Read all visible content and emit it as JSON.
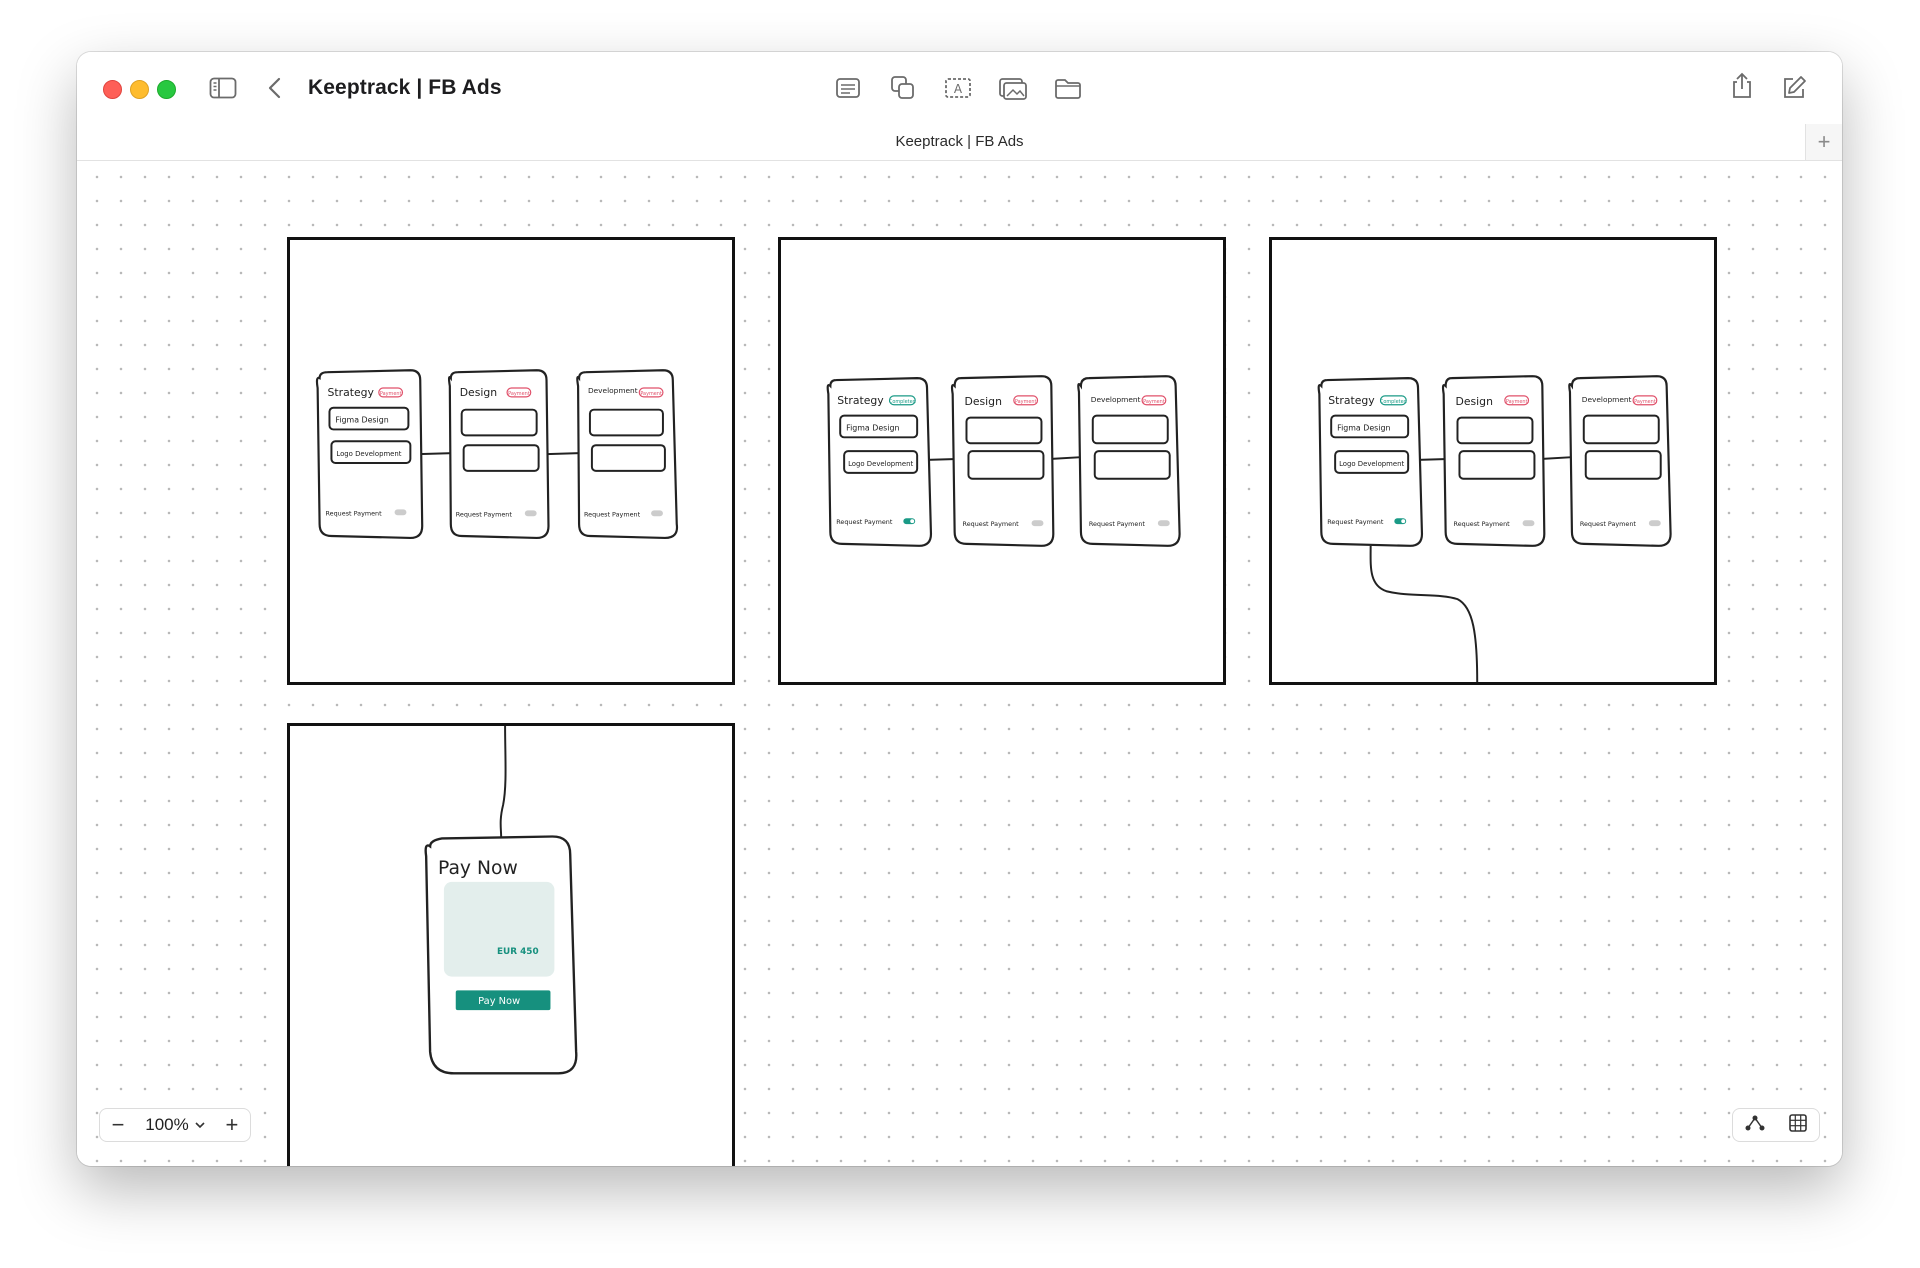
{
  "app": {
    "window_title": "Keeptrack | FB Ads",
    "tab_title": "Keeptrack | FB Ads"
  },
  "toolbar": {
    "left": [
      "sidebar-toggle-icon",
      "back-chevron-icon"
    ],
    "center": [
      "text-list-icon",
      "shapes-icon",
      "text-box-icon",
      "media-icon",
      "folder-icon"
    ],
    "right": [
      "share-icon",
      "compose-icon"
    ],
    "tab_add_label": "+"
  },
  "board": {
    "frames": [
      {
        "columns": [
          {
            "title": "Strategy",
            "badge": "Payment",
            "items": [
              "Figma Design",
              "Logo Development"
            ],
            "footer": "Request Payment",
            "toggle_on": false
          },
          {
            "title": "Design",
            "badge": "Payment",
            "items": [
              "",
              ""
            ],
            "footer": "Request Payment",
            "toggle_on": false
          },
          {
            "title": "Development",
            "badge": "Payment",
            "items": [
              "",
              ""
            ],
            "footer": "Request Payment",
            "toggle_on": false
          }
        ]
      },
      {
        "columns": [
          {
            "title": "Strategy",
            "badge": "Completed",
            "items": [
              "Figma Design",
              "Logo Development"
            ],
            "footer": "Request Payment",
            "toggle_on": true
          },
          {
            "title": "Design",
            "badge": "Payment",
            "items": [
              "",
              ""
            ],
            "footer": "Request Payment",
            "toggle_on": false
          },
          {
            "title": "Development",
            "badge": "Payment",
            "items": [
              "",
              ""
            ],
            "footer": "Request Payment",
            "toggle_on": false
          }
        ]
      },
      {
        "columns": [
          {
            "title": "Strategy",
            "badge": "Completed",
            "items": [
              "Figma Design",
              "Logo Development"
            ],
            "footer": "Request Payment",
            "toggle_on": true
          },
          {
            "title": "Design",
            "badge": "Payment",
            "items": [
              "",
              ""
            ],
            "footer": "Request Payment",
            "toggle_on": false
          },
          {
            "title": "Development",
            "badge": "Payment",
            "items": [
              "",
              ""
            ],
            "footer": "Request Payment",
            "toggle_on": false
          }
        ]
      },
      {
        "pay_card": {
          "title": "Pay Now",
          "amount": "EUR 450",
          "button": "Pay Now"
        }
      }
    ],
    "colors": {
      "completed": "#1a9a86",
      "payment": "#e0506a",
      "pay_button": "#16907e",
      "amount": "#16907e",
      "pay_panel": "#e3eeec"
    }
  },
  "zoom": {
    "minus": "−",
    "value": "100%",
    "plus": "+"
  },
  "view_controls": [
    "connector-icon",
    "grid-icon"
  ]
}
